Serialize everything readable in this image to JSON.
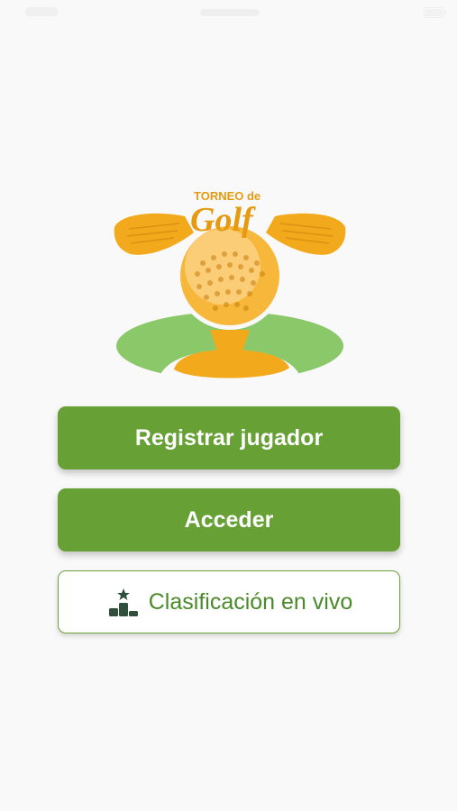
{
  "logo": {
    "line1": "TORNEO de",
    "line2": "Golf"
  },
  "buttons": {
    "register_label": "Registrar jugador",
    "login_label": "Acceder",
    "ranking_label": "Clasificación en vivo"
  },
  "icons": {
    "ranking": "podium-star-icon"
  },
  "colors": {
    "primary_green": "#67a035",
    "outline_green": "#6aa23a",
    "logo_gold": "#f3a91c",
    "logo_green": "#8bc86a",
    "background": "#f9f9f9"
  }
}
